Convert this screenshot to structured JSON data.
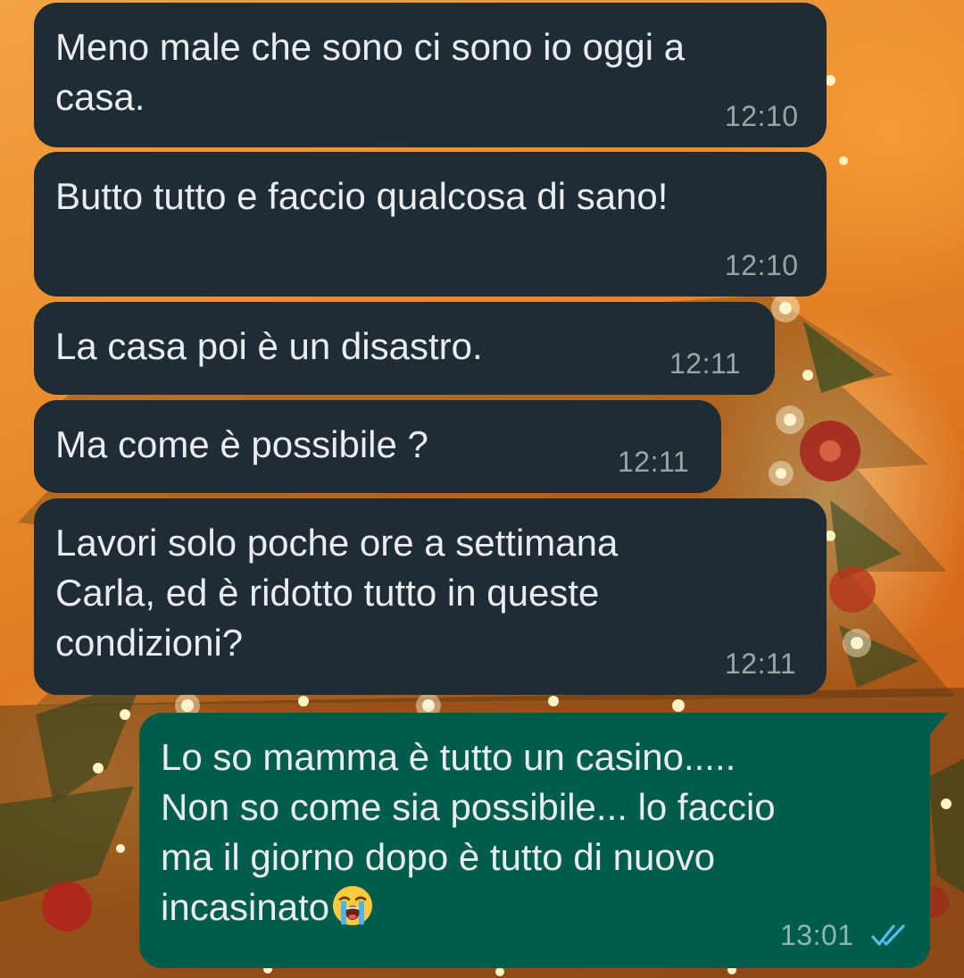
{
  "conversation": {
    "messages": [
      {
        "direction": "incoming",
        "text": "Meno male che sono ci sono io oggi a\ncasa.",
        "time": "12:10"
      },
      {
        "direction": "incoming",
        "text": "Butto tutto e faccio qualcosa di sano!",
        "time": "12:10"
      },
      {
        "direction": "incoming",
        "text": "La casa poi è un disastro.",
        "time": "12:11"
      },
      {
        "direction": "incoming",
        "text": "Ma come è possibile ?",
        "time": "12:11"
      },
      {
        "direction": "incoming",
        "text": "Lavori solo poche ore a settimana\nCarla, ed è ridotto tutto in queste\ncondizioni?",
        "time": "12:11"
      },
      {
        "direction": "outgoing",
        "text": "Lo so mamma è tutto un casino.....\nNon so come sia possibile... lo faccio\nma il giorno dopo è tutto di nuovo\nincasinato",
        "emoji": "loudly-crying-face",
        "time": "13:01",
        "status": "read"
      }
    ]
  },
  "colors": {
    "incoming_bubble": "#202c33",
    "outgoing_bubble": "#005c4b",
    "message_text": "#e9edef",
    "read_ticks": "#53bdeb",
    "wallpaper": "#e88a2c"
  }
}
